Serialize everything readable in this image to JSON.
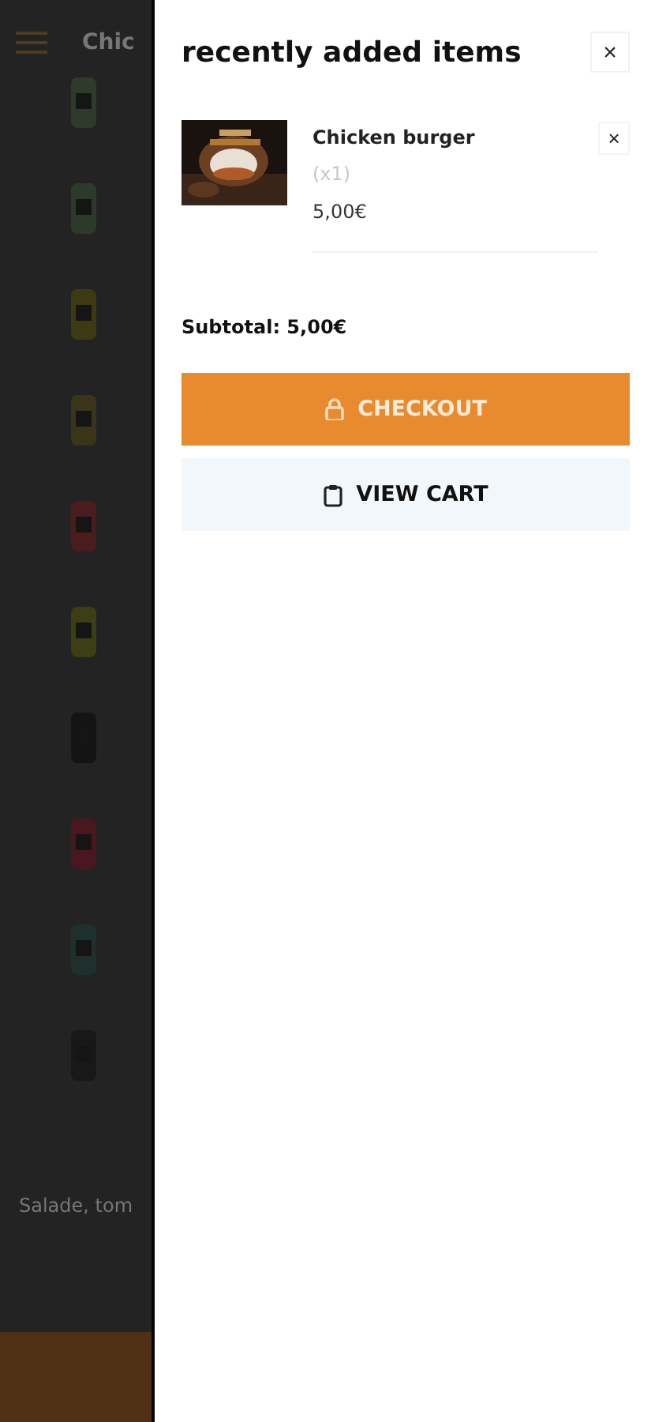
{
  "background_page": {
    "title": "Chic",
    "caption": "Salade, tom"
  },
  "cart_panel": {
    "title": "recently added items",
    "close": "×",
    "items": [
      {
        "name": "Chicken burger",
        "quantity": "(x1)",
        "price": "5,00€",
        "remove": "×"
      }
    ],
    "subtotal_label": "Subtotal:",
    "subtotal": "5,00€",
    "buttons": [
      {
        "kind": "checkout",
        "label": "CHECKOUT"
      },
      {
        "kind": "view_cart",
        "label": "VIEW CART"
      }
    ]
  }
}
